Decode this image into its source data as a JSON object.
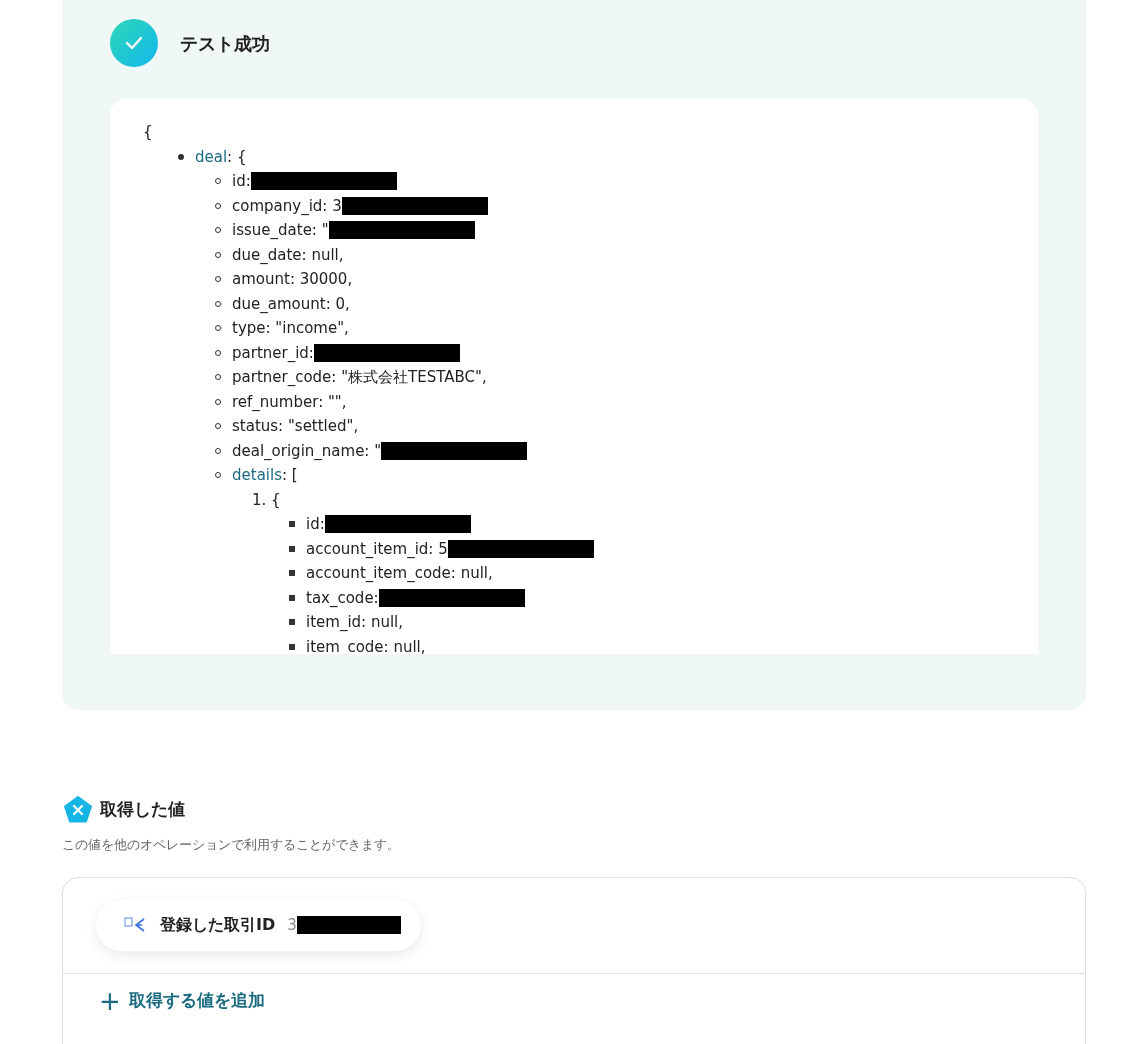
{
  "test_result": {
    "title": "テスト成功",
    "success": true,
    "json_view": {
      "open": "{",
      "items": [
        {
          "key": "deal",
          "text": ": {",
          "children": [
            {
              "text": "id:",
              "redacted": true
            },
            {
              "text": "company_id: 3",
              "redacted": true
            },
            {
              "text": "issue_date: \"",
              "redacted": true
            },
            {
              "text": "due_date: null,",
              "redacted": false
            },
            {
              "text": "amount: 30000,",
              "redacted": false
            },
            {
              "text": "due_amount: 0,",
              "redacted": false
            },
            {
              "text": "type: \"income\",",
              "redacted": false
            },
            {
              "text": "partner_id:",
              "redacted": true
            },
            {
              "text": "partner_code: \"株式会社TESTABC\",",
              "redacted": false
            },
            {
              "text": "ref_number: \"\",",
              "redacted": false
            },
            {
              "text": "status: \"settled\",",
              "redacted": false
            },
            {
              "text": "deal_origin_name: \"",
              "redacted": true
            },
            {
              "key": "details",
              "text": ": [",
              "children": [
                {
                  "marker": "1.",
                  "text": "{",
                  "children": [
                    {
                      "text": "id:",
                      "redacted": true
                    },
                    {
                      "text": "account_item_id: 5",
                      "redacted": true
                    },
                    {
                      "text": "account_item_code: null,",
                      "redacted": false
                    },
                    {
                      "text": "tax_code:",
                      "redacted": true
                    },
                    {
                      "text": "item_id: null,",
                      "redacted": false
                    },
                    {
                      "text": "item_code: null,",
                      "redacted": false
                    }
                  ]
                }
              ]
            }
          ]
        }
      ]
    }
  },
  "acquired_values": {
    "title": "取得した値",
    "description": "この値を他のオペレーションで利用することができます。",
    "values": [
      {
        "label": "登録した取引ID",
        "value": "3",
        "redacted": true
      }
    ],
    "add_button": {
      "icon": "+",
      "label": "取得する値を追加"
    }
  }
}
